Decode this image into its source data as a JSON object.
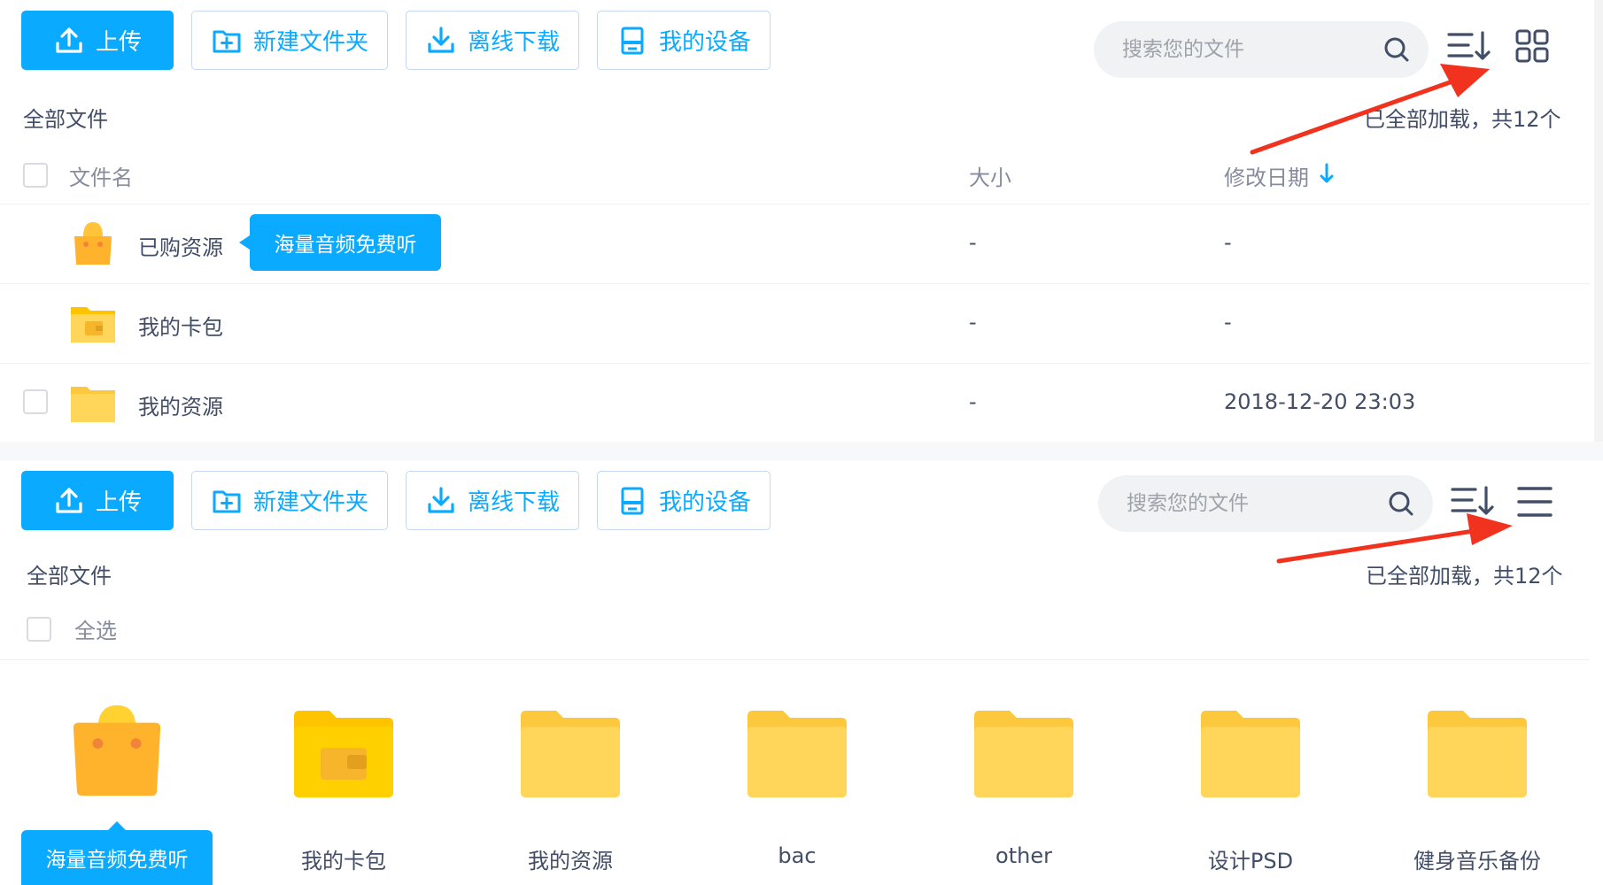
{
  "toolbar": {
    "upload_label": "上传",
    "new_folder_label": "新建文件夹",
    "offline_download_label": "离线下载",
    "my_devices_label": "我的设备"
  },
  "search": {
    "placeholder": "搜索您的文件"
  },
  "breadcrumb": "全部文件",
  "load_status": "已全部加载，共12个",
  "list_view": {
    "columns": {
      "name": "文件名",
      "size": "大小",
      "modified": "修改日期"
    },
    "rows": [
      {
        "name": "已购资源",
        "size": "-",
        "modified": "-",
        "icon": "shopping-bag-icon"
      },
      {
        "name": "我的卡包",
        "size": "-",
        "modified": "-",
        "icon": "wallet-folder-icon"
      },
      {
        "name": "我的资源",
        "size": "-",
        "modified": "2018-12-20 23:03",
        "icon": "folder-icon"
      }
    ],
    "promo_tooltip": "海量音频免费听"
  },
  "grid_view": {
    "select_all": "全选",
    "items": [
      {
        "name": "海量音频免费听",
        "icon": "shopping-bag-icon"
      },
      {
        "name": "我的卡包",
        "icon": "wallet-folder-icon"
      },
      {
        "name": "我的资源",
        "icon": "folder-icon"
      },
      {
        "name": "bac",
        "icon": "folder-icon"
      },
      {
        "name": "other",
        "icon": "folder-icon"
      },
      {
        "name": "设计PSD",
        "icon": "folder-icon"
      },
      {
        "name": "健身音乐备份",
        "icon": "folder-icon"
      }
    ]
  },
  "colors": {
    "accent": "#09AAFF",
    "folder": "#FFD659",
    "annotation_arrow": "#F0321E"
  }
}
